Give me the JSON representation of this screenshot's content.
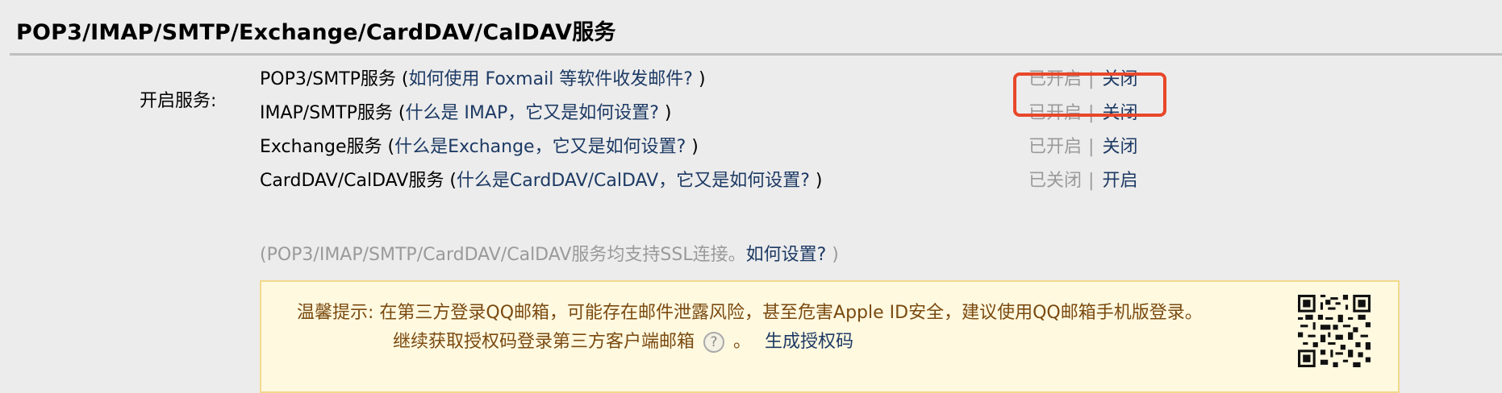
{
  "section": {
    "title": "POP3/IMAP/SMTP/Exchange/CardDAV/CalDAV服务"
  },
  "services_label": "开启服务:",
  "services": [
    {
      "name": "POP3/SMTP服务",
      "paren_open": " (",
      "help_link": "如何使用 Foxmail 等软件收发邮件?",
      "paren_close": " )",
      "status": "已开启",
      "separator": "|",
      "action": "关闭"
    },
    {
      "name": "IMAP/SMTP服务",
      "paren_open": " (",
      "help_link": "什么是 IMAP，它又是如何设置?",
      "paren_close": " )",
      "status": "已开启",
      "separator": "|",
      "action": "关闭"
    },
    {
      "name": "Exchange服务",
      "paren_open": " (",
      "help_link": "什么是Exchange，它又是如何设置?",
      "paren_close": " )",
      "status": "已开启",
      "separator": "|",
      "action": "关闭"
    },
    {
      "name": "CardDAV/CalDAV服务",
      "paren_open": " (",
      "help_link": "什么是CardDAV/CalDAV，它又是如何设置?",
      "paren_close": " )",
      "status": "已关闭",
      "separator": "|",
      "action": "开启"
    }
  ],
  "ssl_note": {
    "text": "(POP3/IMAP/SMTP/CardDAV/CalDAV服务均支持SSL连接。",
    "link": "如何设置?",
    "close": " )"
  },
  "tip": {
    "line1": "温馨提示: 在第三方登录QQ邮箱，可能存在邮件泄露风险，甚至危害Apple ID安全，建议使用QQ邮箱手机版登录。",
    "line2": "继续获取授权码登录第三方客户端邮箱",
    "help_icon_glyph": "?",
    "period": "。",
    "generate_link": "生成授权码"
  },
  "icons": {
    "help": "question-circle-icon",
    "qr": "qr-code-icon"
  },
  "colors": {
    "highlight": "#e8472a",
    "link": "#1d3a64",
    "muted": "#9a9a9a",
    "tip_bg": "#fff9e0",
    "tip_border": "#f3d98d",
    "tip_text": "#7a4a10"
  }
}
